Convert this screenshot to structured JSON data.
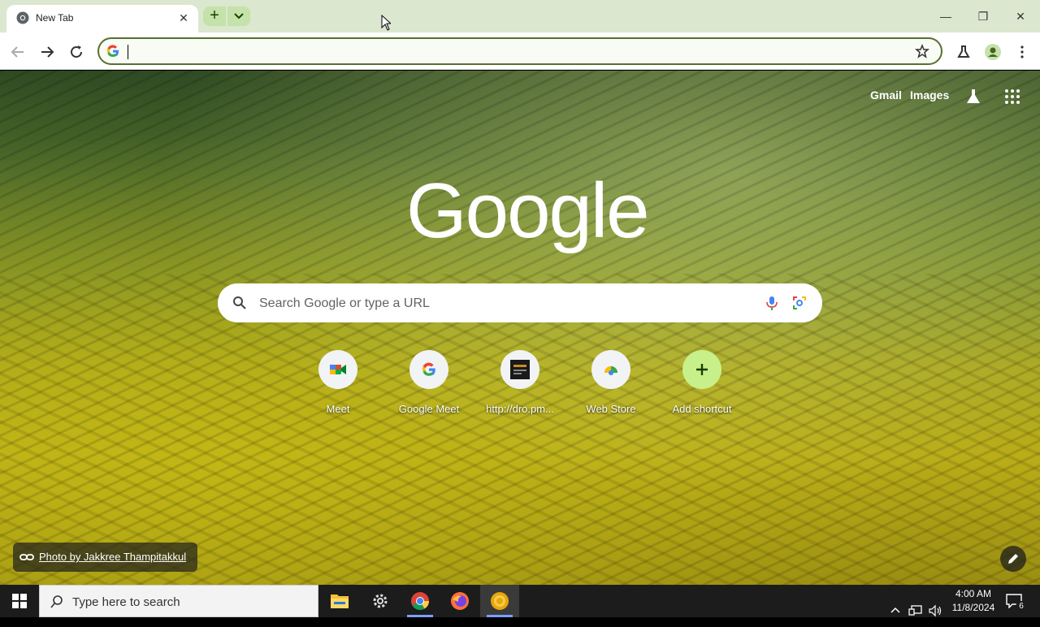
{
  "tab": {
    "title": "New Tab",
    "close": "✕"
  },
  "window": {
    "minimize": "—",
    "maximize": "❐",
    "close": "✕"
  },
  "toolbar": {
    "new_tab": "+"
  },
  "ntp": {
    "gmail": "Gmail",
    "images": "Images",
    "logo": "Google",
    "search_placeholder": "Search Google or type a URL",
    "shortcuts": [
      {
        "label": "Meet"
      },
      {
        "label": "Google Meet"
      },
      {
        "label": "http://dro.pm..."
      },
      {
        "label": "Web Store"
      },
      {
        "label": "Add shortcut"
      }
    ],
    "photo_credit": "Photo by Jakkree Thampitakkul"
  },
  "taskbar": {
    "search_placeholder": "Type here to search",
    "time": "4:00 AM",
    "date": "11/8/2024",
    "notifications": "6"
  },
  "colors": {
    "tabstrip": "#dbe7cf",
    "omnibox_border": "#57702f",
    "newtab_button": "#c4e2a9",
    "add_shortcut": "#c8f08a"
  }
}
